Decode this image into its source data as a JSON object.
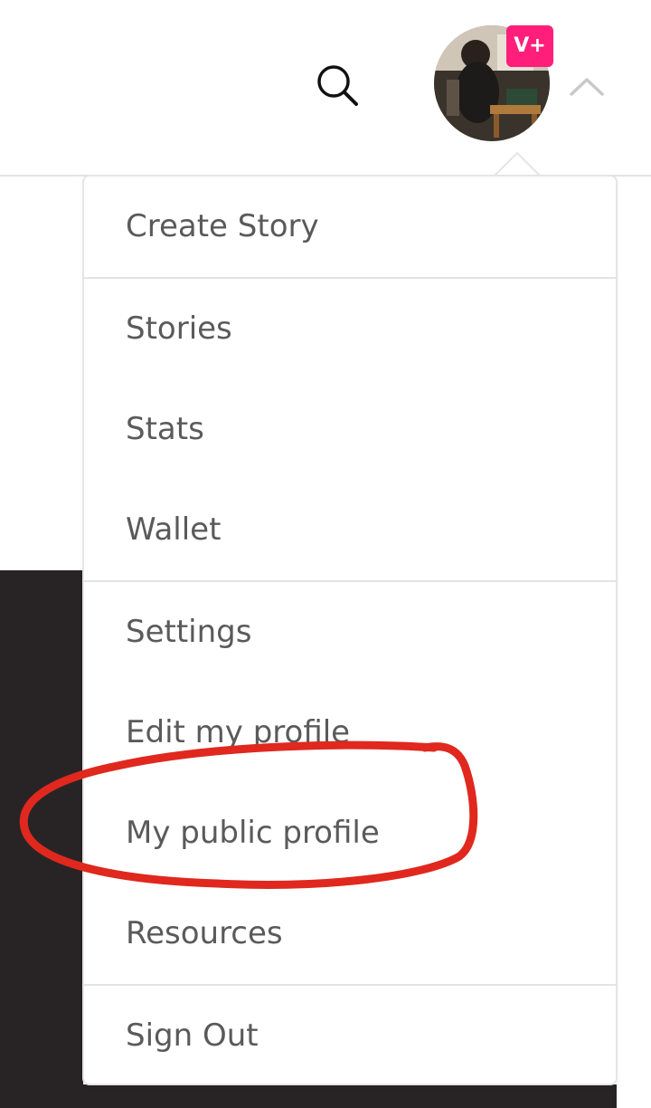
{
  "header": {
    "badge_label": "V+"
  },
  "menu": {
    "sections": [
      {
        "items": [
          {
            "label": "Create Story"
          }
        ]
      },
      {
        "items": [
          {
            "label": "Stories"
          },
          {
            "label": "Stats"
          },
          {
            "label": "Wallet"
          }
        ]
      },
      {
        "items": [
          {
            "label": "Settings"
          },
          {
            "label": "Edit my profile"
          },
          {
            "label": "My public profile"
          },
          {
            "label": "Resources"
          }
        ]
      },
      {
        "items": [
          {
            "label": "Sign Out"
          }
        ]
      }
    ]
  },
  "colors": {
    "badge": "#ff1f7a",
    "annotation": "#e0281e",
    "text": "#5a5a5a",
    "dark_panel": "#282426"
  },
  "icons": [
    "search-icon",
    "chevron-up-icon"
  ]
}
